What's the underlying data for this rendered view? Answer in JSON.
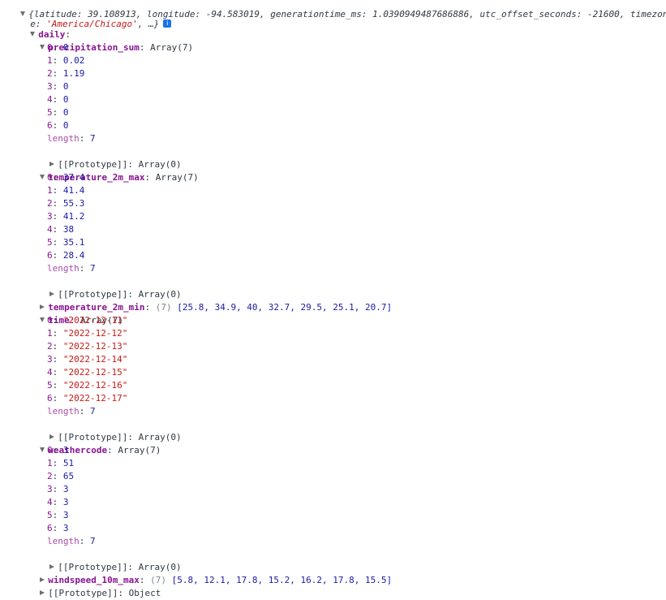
{
  "header": {
    "summary_line": "{latitude: 39.108913, longitude: -94.583019, generationtime_ms: 1.0390949487686886, utc_offset_seconds: -21600, timezon",
    "summary_prefix": "e: ",
    "timezone_value": "'America/Chicago'",
    "summary_suffix": ", …}",
    "info_icon": "i"
  },
  "daily": {
    "key": "daily",
    "precipitation_sum": {
      "key": "precipitation_sum",
      "type": "Array(7)",
      "items": [
        "0",
        "0.02",
        "1.19",
        "0",
        "0",
        "0",
        "0"
      ]
    },
    "temperature_2m_max": {
      "key": "temperature_2m_max",
      "type": "Array(7)",
      "items": [
        "37.4",
        "41.4",
        "55.3",
        "41.2",
        "38",
        "35.1",
        "28.4"
      ]
    },
    "temperature_2m_min": {
      "key": "temperature_2m_min",
      "count": "(7)",
      "preview": "[25.8, 34.9, 40, 32.7, 29.5, 25.1, 20.7]"
    },
    "time": {
      "key": "time",
      "type": "Array(7)",
      "items": [
        "\"2022-12-11\"",
        "\"2022-12-12\"",
        "\"2022-12-13\"",
        "\"2022-12-14\"",
        "\"2022-12-15\"",
        "\"2022-12-16\"",
        "\"2022-12-17\""
      ]
    },
    "weathercode": {
      "key": "weathercode",
      "type": "Array(7)",
      "items": [
        "3",
        "51",
        "65",
        "3",
        "3",
        "3",
        "3"
      ]
    },
    "windspeed_10m_max": {
      "key": "windspeed_10m_max",
      "count": "(7)",
      "preview": "[5.8, 12.1, 17.8, 15.2, 16.2, 17.8, 15.5]"
    }
  },
  "labels": {
    "length": "length",
    "length_value": "7",
    "prototype": "[[Prototype]]",
    "array_proto": "Array(0)",
    "object_proto": "Object",
    "idx0": "0",
    "idx1": "1",
    "idx2": "2",
    "idx3": "3",
    "idx4": "4",
    "idx5": "5",
    "idx6": "6"
  }
}
